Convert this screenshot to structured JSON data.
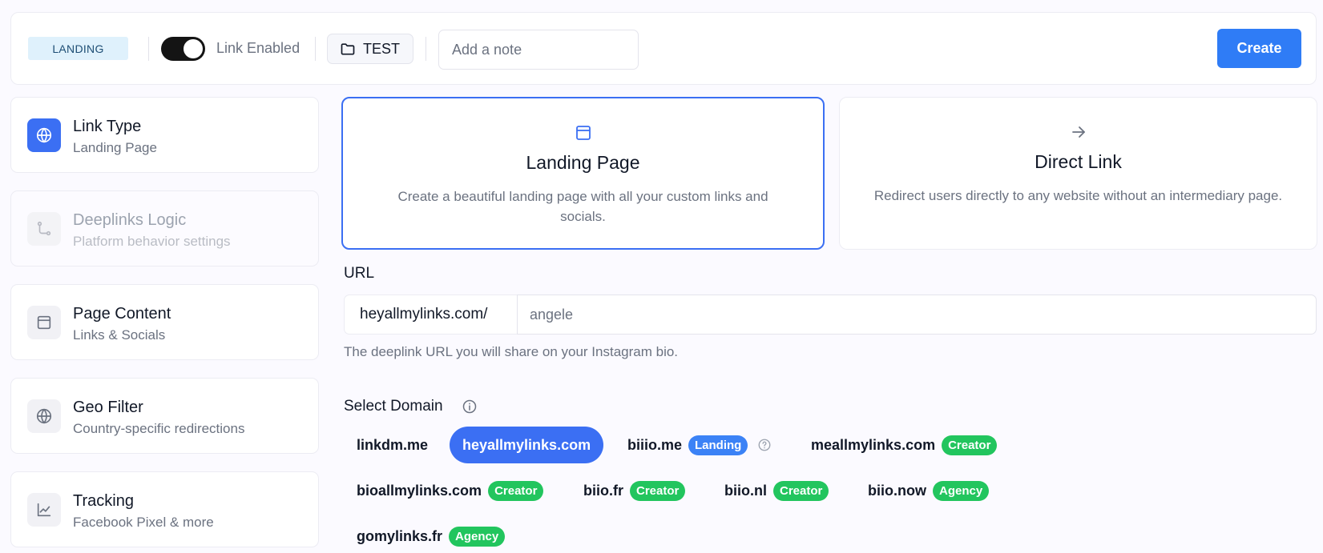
{
  "topbar": {
    "mode_badge": "LANDING",
    "toggle": {
      "on": true
    },
    "toggle_label": "Link Enabled",
    "folder": {
      "icon": "folder-icon",
      "label": "TEST"
    },
    "note": {
      "placeholder": "Add a note",
      "value": ""
    },
    "create_label": "Create"
  },
  "sidebar": {
    "items": [
      {
        "title": "Link Type",
        "subtitle": "Landing Page",
        "icon": "globe-icon",
        "state": "active"
      },
      {
        "title": "Deeplinks Logic",
        "subtitle": "Platform behavior settings",
        "icon": "git-branch-icon",
        "state": "disabled"
      },
      {
        "title": "Page Content",
        "subtitle": "Links & Socials",
        "icon": "layout-icon",
        "state": "default"
      },
      {
        "title": "Geo Filter",
        "subtitle": "Country-specific redirections",
        "icon": "globe-icon",
        "state": "default"
      },
      {
        "title": "Tracking",
        "subtitle": "Facebook Pixel & more",
        "icon": "line-chart-icon",
        "state": "default"
      }
    ]
  },
  "link_types": [
    {
      "title": "Landing Page",
      "description": "Create a beautiful landing page with all your custom links and socials.",
      "icon": "layout-icon",
      "selected": true
    },
    {
      "title": "Direct Link",
      "description": "Redirect users directly to any website without an intermediary page.",
      "icon": "arrow-right-icon",
      "selected": false
    }
  ],
  "url": {
    "label": "URL",
    "prefix": "heyallmylinks.com/",
    "value": "angele",
    "help": "The deeplink URL you will share on your Instagram bio."
  },
  "domains": {
    "label": "Select Domain",
    "items": [
      {
        "name": "linkdm.me",
        "tier": "",
        "selected": false
      },
      {
        "name": "heyallmylinks.com",
        "tier": "",
        "selected": true
      },
      {
        "name": "biiio.me",
        "tier": "Landing",
        "selected": false,
        "help_icon": true
      },
      {
        "name": "meallmylinks.com",
        "tier": "Creator",
        "selected": false
      },
      {
        "name": "bioallmylinks.com",
        "tier": "Creator",
        "selected": false
      },
      {
        "name": "biio.fr",
        "tier": "Creator",
        "selected": false
      },
      {
        "name": "biio.nl",
        "tier": "Creator",
        "selected": false
      },
      {
        "name": "biio.now",
        "tier": "Agency",
        "selected": false
      },
      {
        "name": "gomylinks.fr",
        "tier": "Agency",
        "selected": false
      }
    ]
  },
  "colors": {
    "accent": "#3b6ff3",
    "create_button": "#2f7cf6",
    "badge_landing": "#3b82f6",
    "badge_creator": "#22c55e",
    "badge_agency": "#22c55e",
    "mode_badge_bg": "#dff1fc"
  }
}
